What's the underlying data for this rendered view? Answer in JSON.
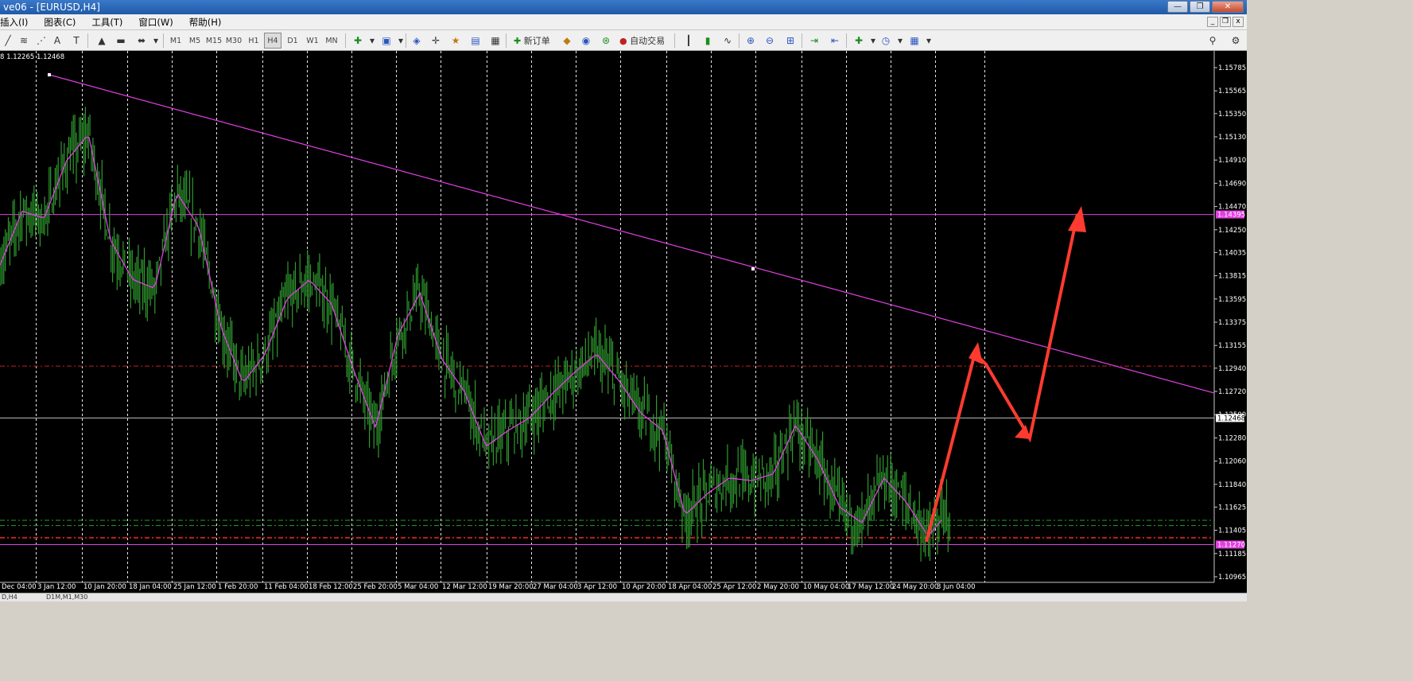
{
  "window": {
    "title": "ve06 - [EURUSD,H4]",
    "buttons": [
      "—",
      "❐",
      "✕"
    ]
  },
  "menu": {
    "items": [
      "插入(I)",
      "图表(C)",
      "工具(T)",
      "窗口(W)",
      "帮助(H)"
    ]
  },
  "toolbar": {
    "timeframes": [
      "M1",
      "M5",
      "M15",
      "M30",
      "H1",
      "H4",
      "D1",
      "W1",
      "MN"
    ],
    "active_timeframe": "H4",
    "new_order_label": "新订单",
    "auto_trade_label": "自动交易"
  },
  "chart": {
    "ohlc_text": "8 1.12265 1.12468",
    "price_labels": [
      "1.15785",
      "1.15565",
      "1.15350",
      "1.15130",
      "1.14910",
      "1.14690",
      "1.14470",
      "1.14250",
      "1.14035",
      "1.13815",
      "1.13595",
      "1.13375",
      "1.13155",
      "1.12940",
      "1.12720",
      "1.12500",
      "1.12280",
      "1.12060",
      "1.11840",
      "1.11625",
      "1.11405",
      "1.11185",
      "1.10965"
    ],
    "highlight_labels": {
      "upper": "1.14395",
      "current": "1.12468",
      "lower": "1.11270"
    },
    "time_labels": [
      "Dec 04:00",
      "3 Jan 12:00",
      "10 Jan 20:00",
      "18 Jan 04:00",
      "25 Jan 12:00",
      "1 Feb 20:00",
      "11 Feb 04:00",
      "18 Feb 12:00",
      "25 Feb 20:00",
      "5 Mar 04:00",
      "12 Mar 12:00",
      "19 Mar 20:00",
      "27 Mar 04:00",
      "3 Apr 12:00",
      "10 Apr 20:00",
      "18 Apr 04:00",
      "25 Apr 12:00",
      "2 May 20:00",
      "10 May 04:00",
      "17 May 12:00",
      "24 May 20:00",
      "3 Jun 04:00"
    ],
    "colors": {
      "candles": "#2f9a2f",
      "ma": "#e040e0",
      "trendline": "#e040e0",
      "arrow": "#ff3b2f",
      "levels_red": "#c02020",
      "levels_green": "#2f9a2f"
    },
    "ma_path": [
      [
        1.1388,
        1.1395
      ],
      [
        1.144,
        1.1445
      ],
      [
        1.1425,
        1.1447
      ],
      [
        1.146,
        1.152
      ],
      [
        1.1541,
        1.149
      ],
      [
        1.143,
        1.14
      ],
      [
        1.1386,
        1.137
      ],
      [
        1.1339,
        1.14
      ],
      [
        1.145,
        1.147
      ],
      [
        1.1445,
        1.141
      ],
      [
        1.135,
        1.1315
      ],
      [
        1.129,
        1.127
      ],
      [
        1.13,
        1.1315
      ],
      [
        1.135,
        1.137
      ],
      [
        1.1375,
        1.138
      ],
      [
        1.137,
        1.134
      ],
      [
        1.131,
        1.1275
      ],
      [
        1.1225,
        1.125
      ],
      [
        1.13,
        1.135
      ],
      [
        1.138,
        1.135
      ],
      [
        1.1305,
        1.13
      ],
      [
        1.1295,
        1.125
      ],
      [
        1.121,
        1.123
      ],
      [
        1.1225,
        1.1245
      ],
      [
        1.124,
        1.1255
      ],
      [
        1.126,
        1.128
      ],
      [
        1.129,
        1.129
      ],
      [
        1.131,
        1.1305
      ],
      [
        1.1295,
        1.127
      ],
      [
        1.1258,
        1.1245
      ],
      [
        1.124,
        1.123
      ],
      [
        1.1165,
        1.1145
      ],
      [
        1.115,
        1.12
      ],
      [
        1.1195,
        1.1185
      ],
      [
        1.1195,
        1.118
      ],
      [
        1.1188,
        1.12
      ],
      [
        1.124,
        1.124
      ],
      [
        1.121,
        1.1205
      ],
      [
        1.117,
        1.1155
      ],
      [
        1.115,
        1.1145
      ],
      [
        1.1185,
        1.1195
      ],
      [
        1.119,
        1.1145
      ],
      [
        1.113,
        1.114
      ],
      [
        1.115,
        1.117
      ]
    ]
  },
  "bottom_tabs": [
    "D,H4",
    "D1M,M1,M30"
  ]
}
